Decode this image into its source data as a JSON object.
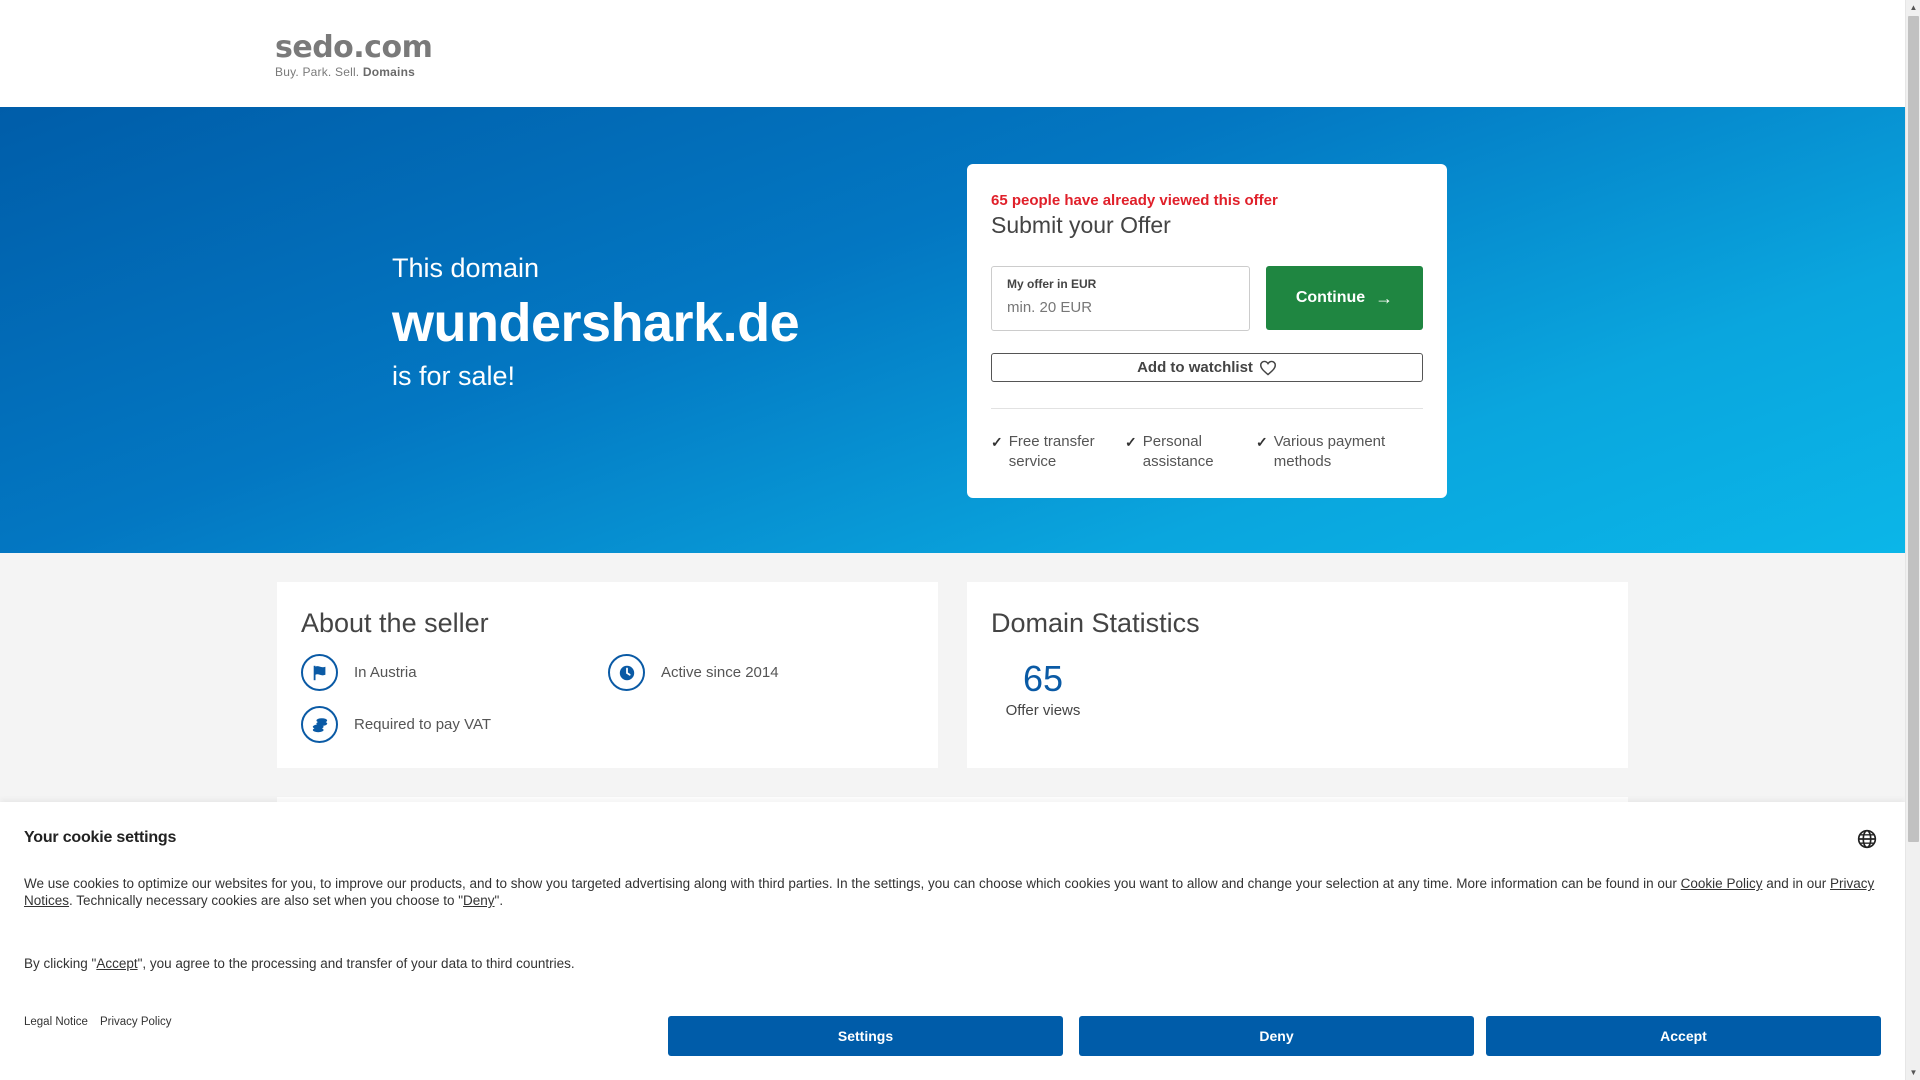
{
  "header": {
    "logo_main": "sedo.com",
    "logo_tagline_plain": "Buy.  Park.  Sell.",
    "logo_tagline_bold": "Domains"
  },
  "hero": {
    "pre": "This domain",
    "domain": "wundershark.de",
    "post": "is for sale!"
  },
  "offer": {
    "viewed_notice": "65 people have already viewed this offer",
    "title": "Submit your Offer",
    "input_label": "My offer in EUR",
    "input_placeholder": "min. 20 EUR",
    "input_value": "",
    "continue_label": "Continue",
    "continue_icon": "arrow-right-icon",
    "watchlist_label": "Add to watchlist",
    "watchlist_icon": "heart-icon",
    "features": [
      {
        "line1": "Free transfer",
        "line2": "service"
      },
      {
        "line1": "Personal",
        "line2": "assistance"
      },
      {
        "line1": "Various payment",
        "line2": "methods"
      }
    ]
  },
  "seller": {
    "title": "About the seller",
    "items": [
      {
        "icon": "flag-icon",
        "label": "In Austria"
      },
      {
        "icon": "clock-icon",
        "label": "Active since 2014"
      },
      {
        "icon": "coins-icon",
        "label": "Required to pay VAT"
      }
    ]
  },
  "stats": {
    "title": "Domain Statistics",
    "offer_views_value": "65",
    "offer_views_label": "Offer views"
  },
  "cookie": {
    "title": "Your cookie settings",
    "text_part1": "We use cookies to optimize our websites for you, to improve our products, and to show you targeted advertising along with third parties. In the settings, you can choose which cookies you want to allow and change your selection at any time. More information can be found in our ",
    "cookie_policy_link": "Cookie Policy",
    "text_part2": " and in our ",
    "privacy_notices_link": "Privacy Notices",
    "text_part3": ". Technically necessary cookies are also set when you choose to \"",
    "deny_link": "Deny",
    "text_part4": "\".",
    "accept_prefix": "By clicking \"",
    "accept_link": "Accept",
    "accept_suffix": "\", you agree to the processing and transfer of your data to third countries.",
    "legal_notice": "Legal Notice",
    "privacy_policy": "Privacy Policy",
    "buttons": {
      "settings": "Settings",
      "deny": "Deny",
      "accept": "Accept"
    }
  },
  "colors": {
    "brand_blue": "#005ca9",
    "continue_green": "#1f8641",
    "alert_red": "#e0202a",
    "hero_gradient_start": "#005da9",
    "hero_gradient_end": "#0bb6e8"
  }
}
